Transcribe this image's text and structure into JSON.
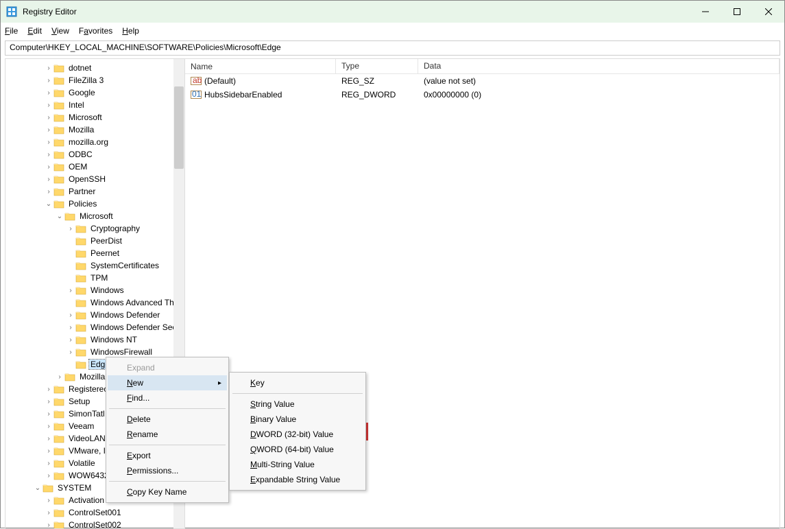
{
  "window": {
    "title": "Registry Editor"
  },
  "menu": {
    "file": "File",
    "edit": "Edit",
    "view": "View",
    "favorites": "Favorites",
    "help": "Help"
  },
  "address": "Computer\\HKEY_LOCAL_MACHINE\\SOFTWARE\\Policies\\Microsoft\\Edge",
  "columns": {
    "name": "Name",
    "type": "Type",
    "data": "Data"
  },
  "values": [
    {
      "name": "(Default)",
      "type": "REG_SZ",
      "data": "(value not set)",
      "icon": "ab"
    },
    {
      "name": "HubsSidebarEnabled",
      "type": "REG_DWORD",
      "data": "0x00000000 (0)",
      "icon": "011"
    }
  ],
  "tree": [
    {
      "indent": 3,
      "chev": "closed",
      "label": "dotnet"
    },
    {
      "indent": 3,
      "chev": "closed",
      "label": "FileZilla 3"
    },
    {
      "indent": 3,
      "chev": "closed",
      "label": "Google"
    },
    {
      "indent": 3,
      "chev": "closed",
      "label": "Intel"
    },
    {
      "indent": 3,
      "chev": "closed",
      "label": "Microsoft"
    },
    {
      "indent": 3,
      "chev": "closed",
      "label": "Mozilla"
    },
    {
      "indent": 3,
      "chev": "closed",
      "label": "mozilla.org"
    },
    {
      "indent": 3,
      "chev": "closed",
      "label": "ODBC"
    },
    {
      "indent": 3,
      "chev": "closed",
      "label": "OEM"
    },
    {
      "indent": 3,
      "chev": "closed",
      "label": "OpenSSH"
    },
    {
      "indent": 3,
      "chev": "closed",
      "label": "Partner"
    },
    {
      "indent": 3,
      "chev": "open",
      "label": "Policies"
    },
    {
      "indent": 4,
      "chev": "open",
      "label": "Microsoft"
    },
    {
      "indent": 5,
      "chev": "closed",
      "label": "Cryptography"
    },
    {
      "indent": 5,
      "chev": "none",
      "label": "PeerDist"
    },
    {
      "indent": 5,
      "chev": "none",
      "label": "Peernet"
    },
    {
      "indent": 5,
      "chev": "none",
      "label": "SystemCertificates"
    },
    {
      "indent": 5,
      "chev": "none",
      "label": "TPM"
    },
    {
      "indent": 5,
      "chev": "closed",
      "label": "Windows"
    },
    {
      "indent": 5,
      "chev": "none",
      "label": "Windows Advanced Th"
    },
    {
      "indent": 5,
      "chev": "closed",
      "label": "Windows Defender"
    },
    {
      "indent": 5,
      "chev": "closed",
      "label": "Windows Defender Sec"
    },
    {
      "indent": 5,
      "chev": "closed",
      "label": "Windows NT"
    },
    {
      "indent": 5,
      "chev": "closed",
      "label": "WindowsFirewall"
    },
    {
      "indent": 5,
      "chev": "none",
      "label": "Edge",
      "selected": true
    },
    {
      "indent": 4,
      "chev": "closed",
      "label": "Mozilla"
    },
    {
      "indent": 3,
      "chev": "closed",
      "label": "Registerec"
    },
    {
      "indent": 3,
      "chev": "closed",
      "label": "Setup"
    },
    {
      "indent": 3,
      "chev": "closed",
      "label": "SimonTatl"
    },
    {
      "indent": 3,
      "chev": "closed",
      "label": "Veeam"
    },
    {
      "indent": 3,
      "chev": "closed",
      "label": "VideoLAN"
    },
    {
      "indent": 3,
      "chev": "closed",
      "label": "VMware, I"
    },
    {
      "indent": 3,
      "chev": "closed",
      "label": "Volatile"
    },
    {
      "indent": 3,
      "chev": "closed",
      "label": "WOW6432"
    },
    {
      "indent": 2,
      "chev": "open",
      "label": "SYSTEM"
    },
    {
      "indent": 3,
      "chev": "closed",
      "label": "Activation"
    },
    {
      "indent": 3,
      "chev": "closed",
      "label": "ControlSet001"
    },
    {
      "indent": 3,
      "chev": "closed",
      "label": "ControlSet002"
    }
  ],
  "context_menu_1": {
    "expand": "Expand",
    "new": "New",
    "find": "Find...",
    "delete": "Delete",
    "rename": "Rename",
    "export": "Export",
    "permissions": "Permissions...",
    "copykey": "Copy Key Name"
  },
  "context_menu_2": {
    "key": "Key",
    "string": "String Value",
    "binary": "Binary Value",
    "dword": "DWORD (32-bit) Value",
    "qword": "QWORD (64-bit) Value",
    "multi": "Multi-String Value",
    "expandable": "Expandable String Value"
  }
}
